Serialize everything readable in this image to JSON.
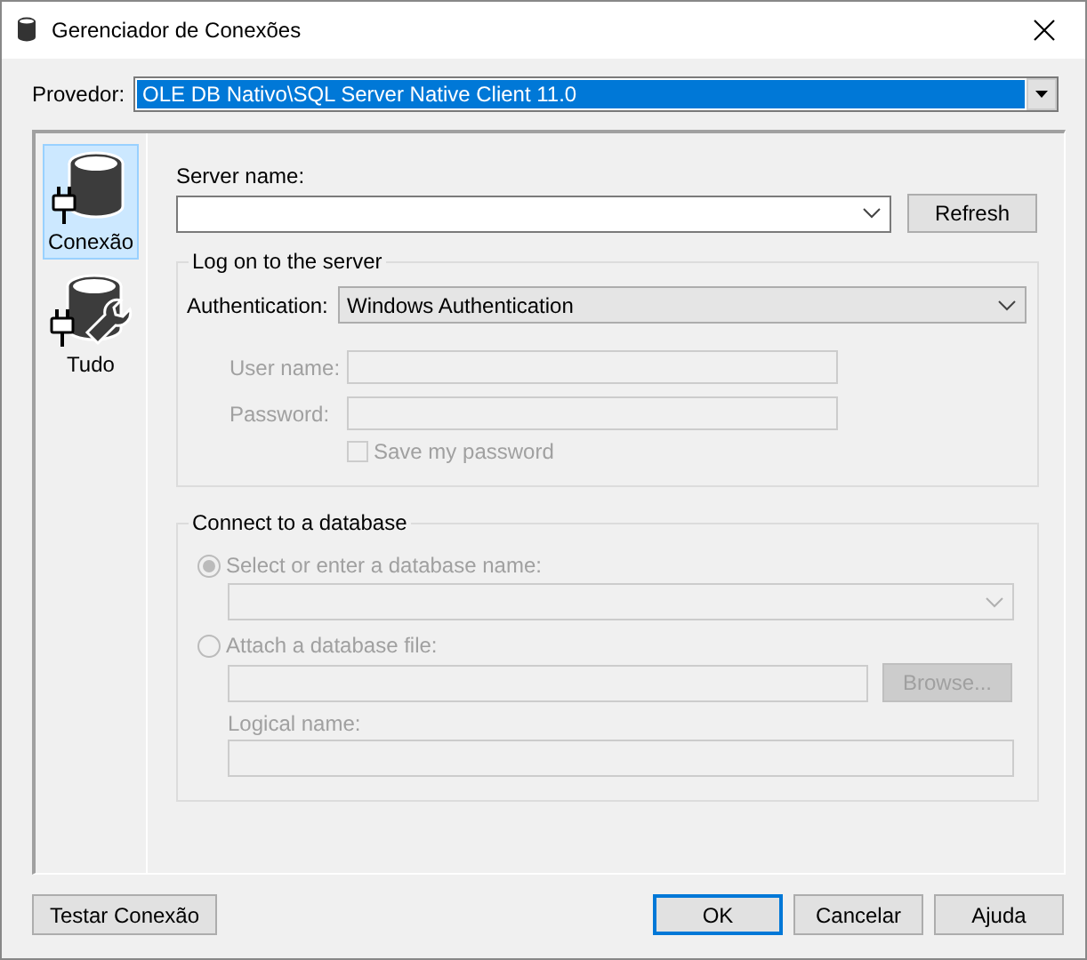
{
  "window": {
    "title": "Gerenciador de Conexões"
  },
  "provider": {
    "label": "Provedor:",
    "value": "OLE DB Nativo\\SQL Server Native Client 11.0"
  },
  "sidebar": {
    "items": [
      {
        "label": "Conexão",
        "kind": "connection",
        "selected": true
      },
      {
        "label": "Tudo",
        "kind": "all",
        "selected": false
      }
    ]
  },
  "server_name": {
    "label": "Server name:",
    "button": "Refresh"
  },
  "logon": {
    "title": "Log on to the server",
    "authentication": {
      "label": "Authentication:",
      "value": "Windows Authentication"
    },
    "user_name": {
      "label": "User name:",
      "disabled": true
    },
    "password": {
      "label": "Password:",
      "disabled": true
    },
    "save_password": {
      "label": "Save my password",
      "checked": false,
      "disabled": true
    }
  },
  "database": {
    "title": "Connect to a database",
    "options": [
      {
        "label": "Select or enter a database name:",
        "selected": true,
        "disabled": true
      },
      {
        "label": "Attach a database file:",
        "selected": false,
        "disabled": true
      }
    ],
    "browse": {
      "label": "Browse...",
      "disabled": true
    },
    "logical_name": {
      "label": "Logical name:",
      "disabled": true
    }
  },
  "buttons": [
    {
      "label": "Testar Conexão",
      "default": false
    },
    {
      "label": "OK",
      "default": true
    },
    {
      "label": "Cancelar",
      "default": false
    },
    {
      "label": "Ajuda",
      "default": false
    }
  ]
}
